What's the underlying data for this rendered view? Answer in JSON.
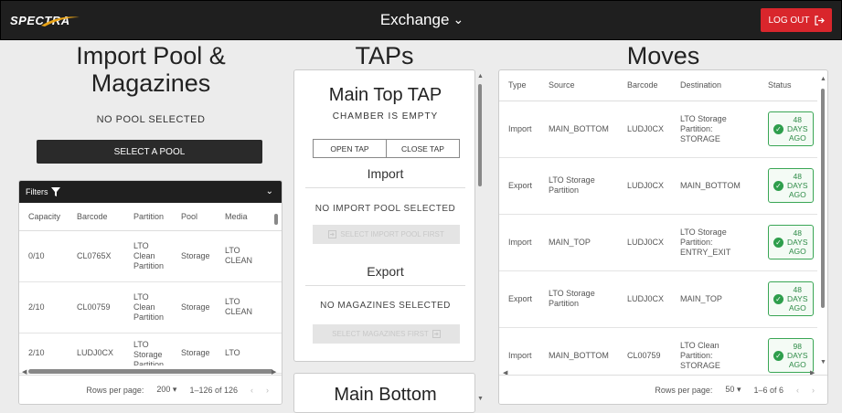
{
  "header": {
    "logo": "SPECTRA",
    "title": "Exchange",
    "logout_label": "LOG OUT"
  },
  "pool": {
    "title_line1": "Import Pool &",
    "title_line2": "Magazines",
    "status": "NO POOL SELECTED",
    "select_label": "SELECT A POOL",
    "filters_label": "Filters",
    "columns": [
      "Capacity",
      "Barcode",
      "Partition",
      "Pool",
      "Media"
    ],
    "rows": [
      {
        "capacity": "0/10",
        "barcode": "CL0765X",
        "partition": [
          "LTO",
          "Clean",
          "Partition"
        ],
        "pool": "Storage",
        "media": [
          "LTO",
          "CLEAN"
        ]
      },
      {
        "capacity": "2/10",
        "barcode": "CL00759",
        "partition": [
          "LTO",
          "Clean",
          "Partition"
        ],
        "pool": "Storage",
        "media": [
          "LTO",
          "CLEAN"
        ]
      },
      {
        "capacity": "2/10",
        "barcode": "LUDJ0CX",
        "partition": [
          "LTO",
          "Storage",
          "Partition"
        ],
        "pool": "Storage",
        "media": [
          "LTO"
        ]
      }
    ],
    "rows_per_page_label": "Rows per page:",
    "rows_per_page": "200",
    "range": "1–126 of 126"
  },
  "taps": {
    "title": "TAPs",
    "card_title": "Main Top TAP",
    "chamber_status": "CHAMBER IS EMPTY",
    "open_label": "OPEN TAP",
    "close_label": "CLOSE TAP",
    "import_title": "Import",
    "import_status": "NO IMPORT POOL SELECTED",
    "import_button": "SELECT IMPORT POOL FIRST",
    "export_title": "Export",
    "export_status": "NO MAGAZINES SELECTED",
    "export_button": "SELECT MAGAZINES FIRST",
    "second_card_title": "Main Bottom"
  },
  "moves": {
    "title": "Moves",
    "columns": [
      "Type",
      "Source",
      "Barcode",
      "Destination",
      "Status"
    ],
    "rows": [
      {
        "type": "Import",
        "source": [
          "MAIN_BOTTOM"
        ],
        "barcode": "LUDJ0CX",
        "destination": [
          "LTO Storage",
          "Partition:",
          "STORAGE"
        ],
        "status": [
          "48",
          "DAYS",
          "AGO"
        ]
      },
      {
        "type": "Export",
        "source": [
          "LTO Storage",
          "Partition"
        ],
        "barcode": "LUDJ0CX",
        "destination": [
          "MAIN_BOTTOM"
        ],
        "status": [
          "48",
          "DAYS",
          "AGO"
        ]
      },
      {
        "type": "Import",
        "source": [
          "MAIN_TOP"
        ],
        "barcode": "LUDJ0CX",
        "destination": [
          "LTO Storage",
          "Partition:",
          "ENTRY_EXIT"
        ],
        "status": [
          "48",
          "DAYS",
          "AGO"
        ]
      },
      {
        "type": "Export",
        "source": [
          "LTO Storage",
          "Partition"
        ],
        "barcode": "LUDJ0CX",
        "destination": [
          "MAIN_TOP"
        ],
        "status": [
          "48",
          "DAYS",
          "AGO"
        ]
      },
      {
        "type": "Import",
        "source": [
          "MAIN_BOTTOM"
        ],
        "barcode": "CL00759",
        "destination": [
          "LTO Clean",
          "Partition:",
          "STORAGE"
        ],
        "status": [
          "98",
          "DAYS",
          "AGO"
        ]
      }
    ],
    "rows_per_page_label": "Rows per page:",
    "rows_per_page": "50",
    "range": "1–6 of 6"
  },
  "colors": {
    "header_bg": "#1f1f1f",
    "logout_bg": "#d9262c",
    "status_green": "#2e9e4c"
  }
}
